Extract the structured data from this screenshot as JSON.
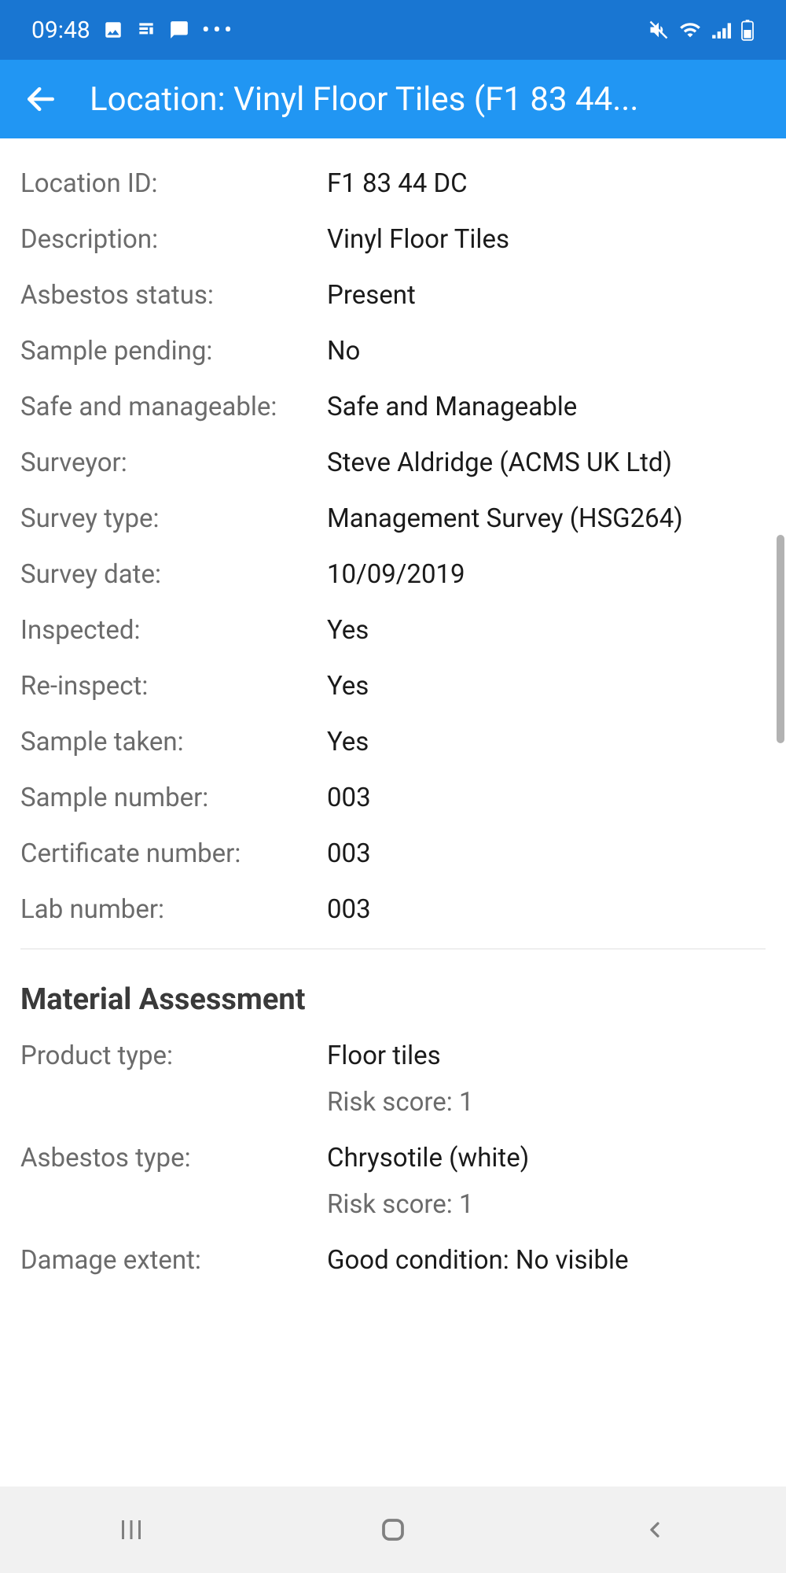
{
  "status_bar": {
    "time": "09:48"
  },
  "header": {
    "title": "Location: Vinyl Floor Tiles (F1 83 44..."
  },
  "details": [
    {
      "label": "Location ID:",
      "value": "F1 83 44 DC"
    },
    {
      "label": "Description:",
      "value": "Vinyl Floor Tiles"
    },
    {
      "label": "Asbestos status:",
      "value": "Present"
    },
    {
      "label": "Sample pending:",
      "value": "No"
    },
    {
      "label": "Safe and manageable:",
      "value": "Safe and Manageable"
    },
    {
      "label": "Surveyor:",
      "value": "Steve Aldridge (ACMS UK Ltd)"
    },
    {
      "label": "Survey type:",
      "value": "Management Survey (HSG264)"
    },
    {
      "label": "Survey date:",
      "value": "10/09/2019"
    },
    {
      "label": "Inspected:",
      "value": "Yes"
    },
    {
      "label": "Re-inspect:",
      "value": "Yes"
    },
    {
      "label": "Sample taken:",
      "value": "Yes"
    },
    {
      "label": "Sample number:",
      "value": "003"
    },
    {
      "label": "Certificate number:",
      "value": "003"
    },
    {
      "label": "Lab number:",
      "value": "003"
    }
  ],
  "section": {
    "title": "Material Assessment"
  },
  "assessments": [
    {
      "label": "Product type:",
      "value": "Floor tiles",
      "risk": "Risk score: 1"
    },
    {
      "label": "Asbestos type:",
      "value": "Chrysotile (white)",
      "risk": "Risk score: 1"
    },
    {
      "label": "Damage extent:",
      "value": "Good condition: No visible"
    }
  ]
}
